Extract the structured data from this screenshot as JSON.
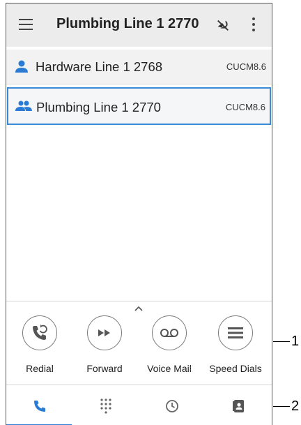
{
  "header": {
    "title": "Plumbing Line 1 2770"
  },
  "lines": [
    {
      "label": "Hardware Line 1 2768",
      "tag": "CUCM8.6"
    },
    {
      "label": "Plumbing Line 1 2770",
      "tag": "CUCM8.6"
    }
  ],
  "quick_actions": [
    {
      "label": "Redial"
    },
    {
      "label": "Forward"
    },
    {
      "label": "Voice Mail"
    },
    {
      "label": "Speed Dials"
    }
  ],
  "callouts": [
    "1",
    "2"
  ],
  "colors": {
    "accent": "#2a7bd4",
    "selected_border": "#3a8ad6",
    "appbar": "#ececec"
  },
  "icons": [
    "menu-icon",
    "mute-icon",
    "more-icon",
    "person-icon",
    "people-icon",
    "redial-icon",
    "forward-icon",
    "voicemail-icon",
    "speed-dial-icon",
    "phone-icon",
    "dialpad-icon",
    "recents-icon",
    "contacts-icon"
  ]
}
